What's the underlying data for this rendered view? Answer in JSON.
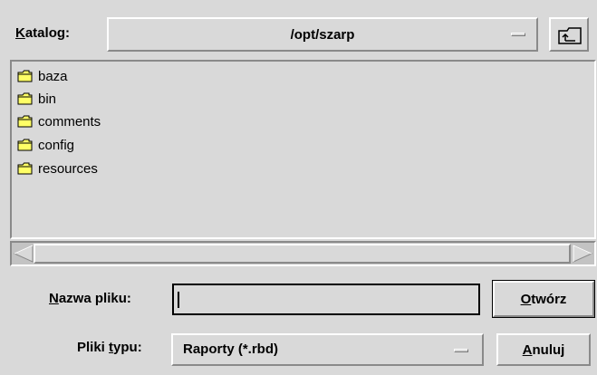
{
  "directory": {
    "label_first": "K",
    "label_rest": "atalog:",
    "path": "/opt/szarp"
  },
  "files": [
    {
      "name": "baza",
      "icon": "folder-icon"
    },
    {
      "name": "bin",
      "icon": "folder-icon"
    },
    {
      "name": "comments",
      "icon": "folder-icon"
    },
    {
      "name": "config",
      "icon": "folder-icon"
    },
    {
      "name": "resources",
      "icon": "folder-icon"
    }
  ],
  "filename": {
    "label_first": "N",
    "label_rest": "azwa pliku:",
    "value": ""
  },
  "filetype": {
    "label_pre": "Pliki ",
    "label_underline": "t",
    "label_rest": "ypu:",
    "value": "Raporty (*.rbd)"
  },
  "buttons": {
    "open_first": "O",
    "open_rest": "twórz",
    "cancel_first": "A",
    "cancel_rest": "nuluj"
  },
  "colors": {
    "folder_fill": "#ffff66",
    "background": "#d9d9d9"
  }
}
